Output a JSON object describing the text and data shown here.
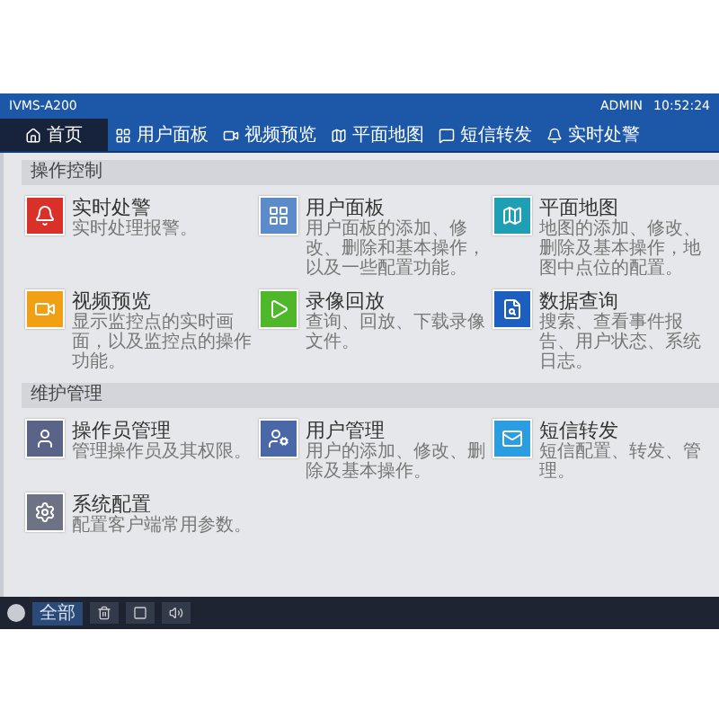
{
  "window": {
    "title": "IVMS-A200",
    "user": "ADMIN",
    "time": "10:52:24"
  },
  "tabs": [
    {
      "label": "首页",
      "selected": true
    },
    {
      "label": "用户面板",
      "selected": false
    },
    {
      "label": "视频预览",
      "selected": false
    },
    {
      "label": "平面地图",
      "selected": false
    },
    {
      "label": "短信转发",
      "selected": false
    },
    {
      "label": "实时处警",
      "selected": false
    }
  ],
  "sections": [
    {
      "title": "操作控制",
      "items": [
        {
          "title": "实时处警",
          "description": "实时处理报警。",
          "color": "#d9302a"
        },
        {
          "title": "用户面板",
          "description": "用户面板的添加、修改、删除和基本操作，以及一些配置功能。",
          "color": "#5b8bc9"
        },
        {
          "title": "平面地图",
          "description": "地图的添加、修改、删除及基本操作，地图中点位的配置。",
          "color": "#1f9fb3"
        },
        {
          "title": "视频预览",
          "description": "显示监控点的实时画面，以及监控点的操作功能。",
          "color": "#f0a012"
        },
        {
          "title": "录像回放",
          "description": "查询、回放、下载录像文件。",
          "color": "#4fb82a"
        },
        {
          "title": "数据查询",
          "description": "搜索、查看事件报告、用户状态、系统日志。",
          "color": "#1d5fc0"
        }
      ]
    },
    {
      "title": "维护管理",
      "items": [
        {
          "title": "操作员管理",
          "description": "管理操作员及其权限。",
          "color": "#5a6388"
        },
        {
          "title": "用户管理",
          "description": "用户的添加、修改、删除及基本操作。",
          "color": "#4a68a8"
        },
        {
          "title": "短信转发",
          "description": "短信配置、转发、管理。",
          "color": "#2a9ee0"
        },
        {
          "title": "系统配置",
          "description": "配置客户端常用参数。",
          "color": "#6d7285"
        }
      ]
    }
  ],
  "status_bar": {
    "button": "全部"
  }
}
